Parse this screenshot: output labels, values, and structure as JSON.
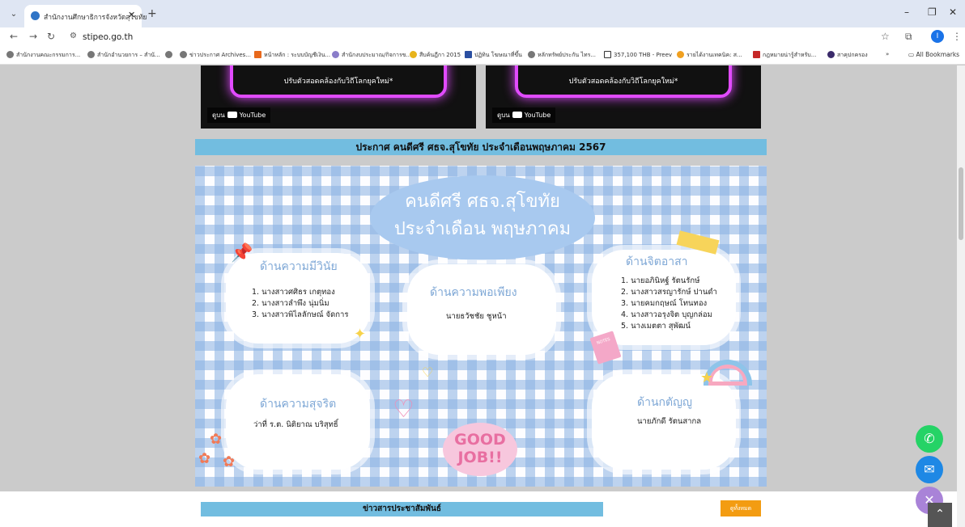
{
  "browser": {
    "tab_title": "สำนักงานศึกษาธิการจังหวัดสุโขทัย",
    "url": "stipeo.go.th",
    "bookmarks": [
      "สำนักงานคณะกรรมการ...",
      "สำนักอำนวยการ – สำนั...",
      "",
      "ข่าวประกาศ Archives...",
      "หน้าหลัก : ระบบบัญชีเงิน...",
      "สำนักงบประมาณ/กิจการข...",
      "สืบค้นฎีกา 2015",
      "ปฏิทิน โฆษณาที่ขึ้น",
      "หลักทรัพย์ประกัน ไทร...",
      "357,100 THB - Preev",
      "รายได้งานเทคนิค: ส...",
      "กฎหมายน่ารู้สำหรับ...",
      "สาคุปกครอง"
    ],
    "all_bookmarks": "All Bookmarks",
    "profile_letter": "I"
  },
  "videos": {
    "caption": "ปรับตัวสอดคล้องกับวิถีโลกยุคใหม่*",
    "watch_on": "ดูบน",
    "youtube": "YouTube"
  },
  "banner_title": "ประกาศ คนดีศรี ศธจ.สุโขทัย ประจำเดือนพฤษภาคม 2567",
  "poster": {
    "title_line1": "คนดีศรี ศธจ.สุโขทัย",
    "title_line2": "ประจำเดือน พฤษภาคม",
    "discipline": {
      "heading": "ด้านความมีวินัย",
      "names": [
        "1. นางสาวศศิธร เกตุทอง",
        "2. นางสาวลำพึง นุ่มนิ่ม",
        "3. นางสาวพิไลลักษณ์ จัดการ"
      ]
    },
    "sufficiency": {
      "heading": "ด้านความพอเพียง",
      "names": [
        "นายธวัชชัย ชูหน้า"
      ]
    },
    "volunteer": {
      "heading": "ด้านจิตอาสา",
      "names": [
        "1. นายอภินิหฐ์ รัตนรักษ์",
        "2. นางสาวสรญารักษ์ ปานดำ",
        "3. นายคมกฤษณ์ โทนทอง",
        "4. นางสาวอรุงจิต บุญกล่อม",
        "5. นางเมตตา สุพัฒน์"
      ]
    },
    "honesty": {
      "heading": "ด้านความสุจริต",
      "names": [
        "ว่าที่ ร.ต. นิติยาณ บริสุทธิ์"
      ]
    },
    "gratitude": {
      "heading": "ด้านกตัญญู",
      "names": [
        "นายภักดี รัตนสากล"
      ]
    },
    "sticker_good": "GOOD",
    "sticker_job": "JOB!!",
    "sticker_note": "NOTES"
  },
  "news_bar": "ข่าวสารประชาสัมพันธ์",
  "see_all": "ดูทั้งหมด",
  "colors": {
    "banner": "#72bde0",
    "phone": "#25d366",
    "messenger": "#1e88e5",
    "close": "#a983d8",
    "see_all": "#f39c12"
  }
}
